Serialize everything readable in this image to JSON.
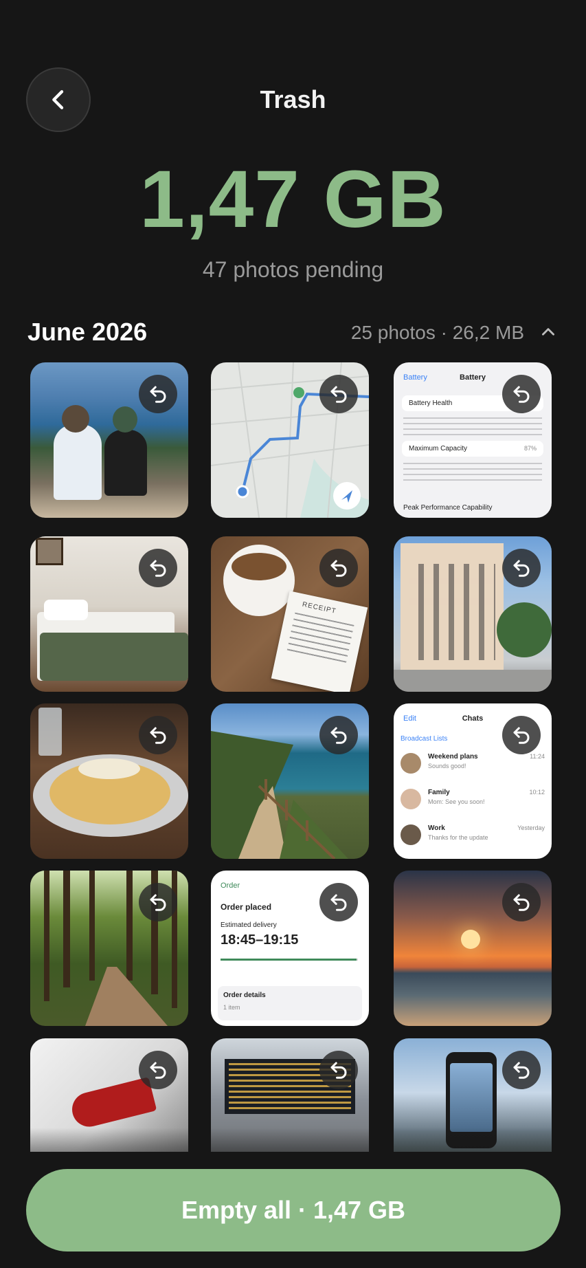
{
  "header": {
    "title": "Trash",
    "back_icon": "chevron-left-icon"
  },
  "summary": {
    "total_size": "1,47 GB",
    "pending_text": "47 photos pending"
  },
  "section": {
    "title": "June 2026",
    "meta": "25 photos · 26,2 MB",
    "collapse_icon": "chevron-up-icon"
  },
  "tiles": [
    {
      "subject": "couple-on-cliff-photo"
    },
    {
      "subject": "map-route-screenshot"
    },
    {
      "subject": "battery-settings-screenshot",
      "nav": "Battery",
      "heading": "Battery",
      "rows": [
        "Battery Health",
        "Maximum Capacity",
        "Peak Performance Capability"
      ],
      "value": "87%"
    },
    {
      "subject": "bedroom-photo"
    },
    {
      "subject": "coffee-receipt-photo",
      "receipt_label": "RECEIPT"
    },
    {
      "subject": "building-street-photo"
    },
    {
      "subject": "pasta-dish-photo"
    },
    {
      "subject": "coastal-path-photo"
    },
    {
      "subject": "chats-screenshot",
      "nav": "Edit",
      "heading": "Chats",
      "broadcast": "Broadcast Lists",
      "chats": [
        {
          "name": "Weekend plans",
          "msg": "Sounds good!",
          "time": "11:24"
        },
        {
          "name": "Family",
          "msg": "Mom: See you soon!",
          "time": "10:12"
        },
        {
          "name": "Work",
          "msg": "Thanks for the update",
          "time": "Yesterday"
        }
      ]
    },
    {
      "subject": "forest-trail-photo"
    },
    {
      "subject": "order-tracking-screenshot",
      "nav": "Order",
      "status": "Order placed",
      "est": "Estimated delivery",
      "window": "18:45–19:15",
      "details": "Order details",
      "items": "1 item"
    },
    {
      "subject": "sunset-beach-photo"
    },
    {
      "subject": "car-taillight-photo"
    },
    {
      "subject": "station-departures-photo"
    },
    {
      "subject": "phone-mountain-photo"
    }
  ],
  "actions": {
    "empty_all_label": "Empty all · 1,47 GB"
  },
  "colors": {
    "accent": "#8dbb88",
    "background": "#161616"
  }
}
